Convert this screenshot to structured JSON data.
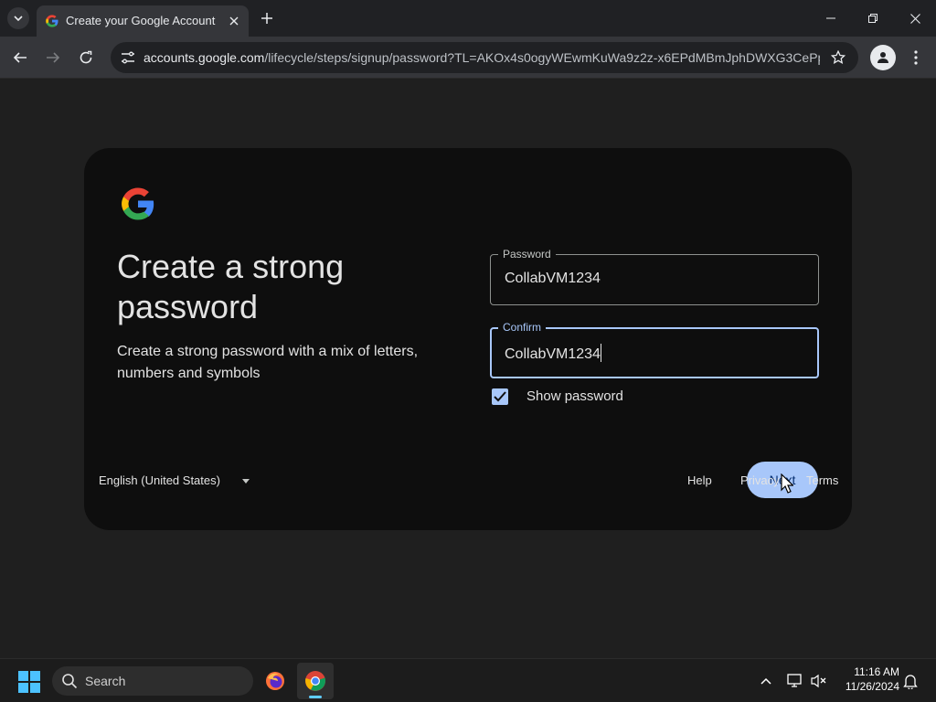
{
  "browser": {
    "tab_title": "Create your Google Account",
    "url_domain": "accounts.google.com",
    "url_path": "/lifecycle/steps/signup/password?TL=AKOx4s0ogyWEwmKuWa9z2z-x6EPdMBmJphDWXG3CePp..."
  },
  "signup": {
    "headline": "Create a strong password",
    "description": "Create a strong password with a mix of letters, numbers and symbols",
    "password_label": "Password",
    "password_value": "CollabVM1234",
    "confirm_label": "Confirm",
    "confirm_value": "CollabVM1234",
    "show_password_label": "Show password",
    "show_password_checked": true,
    "next_label": "Next"
  },
  "footer": {
    "language": "English (United States)",
    "links": [
      "Help",
      "Privacy",
      "Terms"
    ]
  },
  "taskbar": {
    "search_placeholder": "Search",
    "time": "11:16 AM",
    "date": "11/26/2024"
  },
  "colors": {
    "accent": "#a8c7fa",
    "button_text": "#062e6f",
    "card_bg": "#0e0e0e",
    "page_bg": "#1f1f1f"
  }
}
